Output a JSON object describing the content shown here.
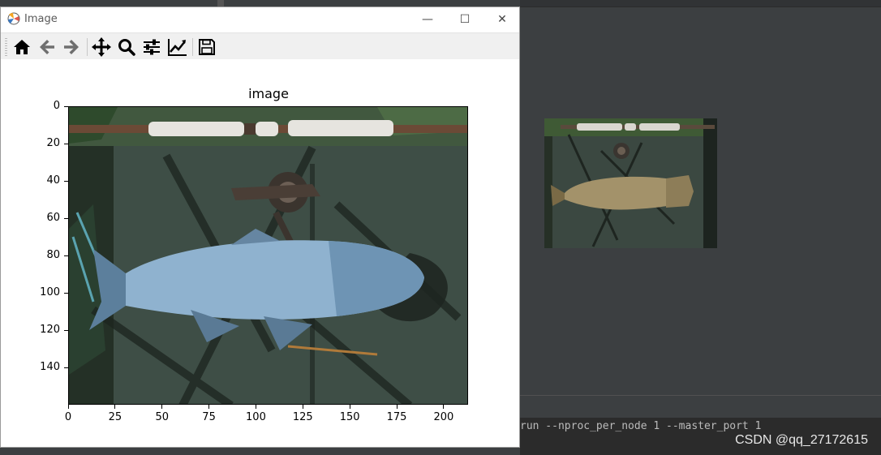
{
  "window": {
    "title": "Image",
    "controls": {
      "minimize": "—",
      "maximize": "☐",
      "close": "✕"
    }
  },
  "toolbar": {
    "buttons": [
      {
        "name": "home",
        "icon": "home-icon"
      },
      {
        "name": "back",
        "icon": "arrow-left-icon"
      },
      {
        "name": "forward",
        "icon": "arrow-right-icon"
      },
      {
        "name": "pan",
        "icon": "move-icon"
      },
      {
        "name": "zoom",
        "icon": "magnifier-icon"
      },
      {
        "name": "subplots",
        "icon": "sliders-icon"
      },
      {
        "name": "customize",
        "icon": "line-chart-icon"
      },
      {
        "name": "save",
        "icon": "floppy-disk-icon"
      }
    ]
  },
  "chart_data": {
    "type": "image",
    "title": "image",
    "xlim": [
      0,
      213
    ],
    "ylim": [
      160,
      0
    ],
    "xticks": [
      0,
      25,
      50,
      75,
      100,
      125,
      150,
      175,
      200
    ],
    "yticks": [
      0,
      20,
      40,
      60,
      80,
      100,
      120,
      140
    ],
    "xlabel": "",
    "ylabel": ""
  },
  "ide": {
    "terminal_text": "run --nproc_per_node 1 --master_port 1"
  },
  "watermark": "CSDN @qq_27172615",
  "colors": {
    "fish_plot": "#8fb2cf",
    "fish_preview": "#a3926a",
    "tarp": "#3e4e46"
  }
}
